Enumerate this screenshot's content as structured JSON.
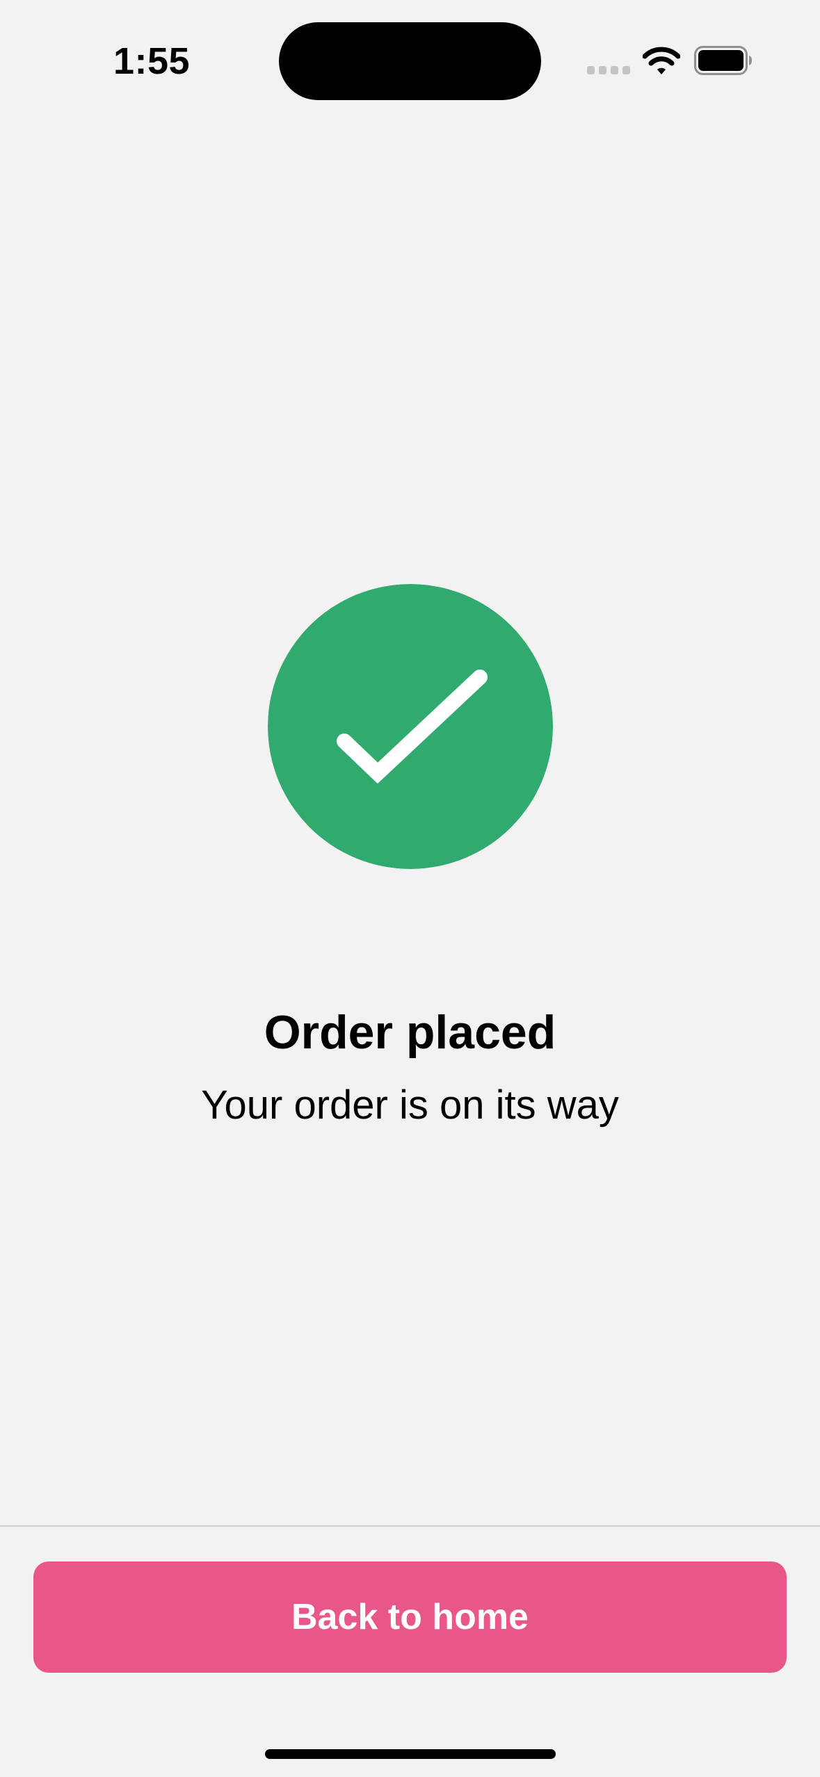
{
  "status_bar": {
    "time": "1:55",
    "signal_icon": "cellular-signal-icon",
    "wifi_icon": "wifi-icon",
    "battery_icon": "battery-icon"
  },
  "confirmation": {
    "icon": "checkmark-circle-icon",
    "title": "Order placed",
    "subtitle": "Your order is on its way"
  },
  "footer": {
    "button_label": "Back to home"
  },
  "colors": {
    "background": "#f2f2f2",
    "success": "#31aa6f",
    "accent": "#e8568a",
    "divider": "#cfcfcf"
  }
}
